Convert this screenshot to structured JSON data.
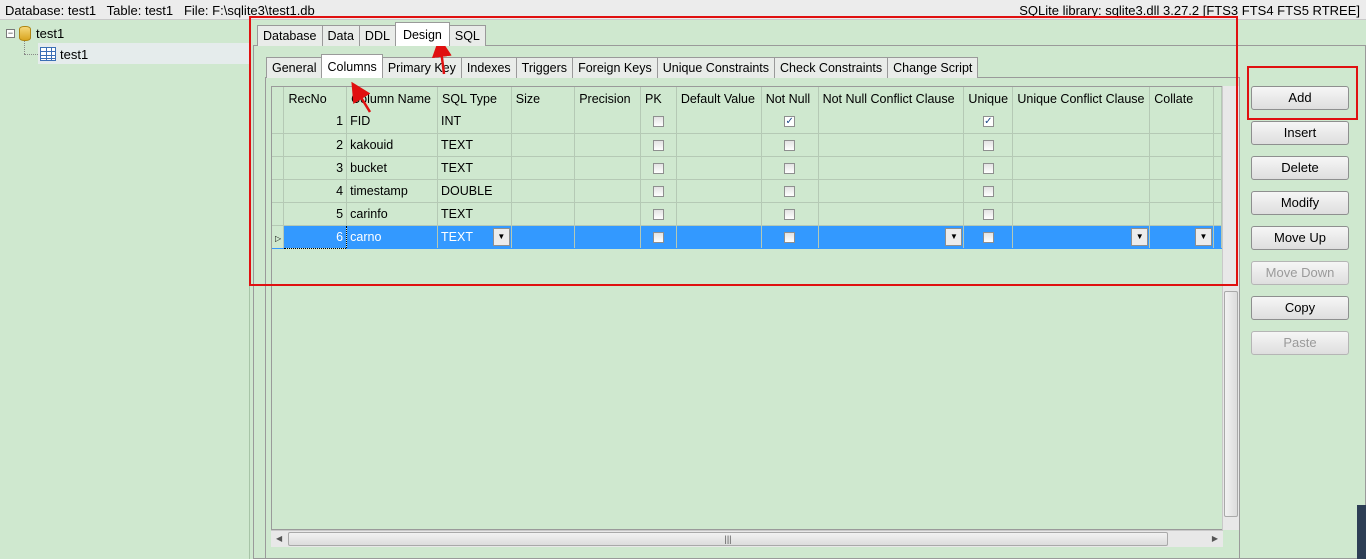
{
  "statusbar": {
    "left": "Database: test1   Table: test1   File: F:\\sqlite3\\test1.db",
    "right": "SQLite library: sqlite3.dll 3.27.2 [FTS3 FTS4 FTS5 RTREE]"
  },
  "tree": {
    "database": "test1",
    "table": "test1"
  },
  "main_tabs": [
    "Database",
    "Data",
    "DDL",
    "Design",
    "SQL"
  ],
  "design_tabs": [
    "General",
    "Columns",
    "Primary Key",
    "Indexes",
    "Triggers",
    "Foreign Keys",
    "Unique Constraints",
    "Check Constraints",
    "Change Script"
  ],
  "grid": {
    "headers": [
      "RecNo",
      "Column Name",
      "SQL Type",
      "Size",
      "Precision",
      "PK",
      "Default Value",
      "Not Null",
      "Not Null Conflict Clause",
      "Unique",
      "Unique Conflict Clause",
      "Collate"
    ],
    "rows": [
      {
        "recno": "1",
        "name": "FID",
        "type": "INT",
        "not_null": true,
        "unique": true
      },
      {
        "recno": "2",
        "name": "kakouid",
        "type": "TEXT",
        "not_null": false,
        "unique": false
      },
      {
        "recno": "3",
        "name": "bucket",
        "type": "TEXT",
        "not_null": false,
        "unique": false
      },
      {
        "recno": "4",
        "name": "timestamp",
        "type": "DOUBLE",
        "not_null": false,
        "unique": false
      },
      {
        "recno": "5",
        "name": "carinfo",
        "type": "TEXT",
        "not_null": false,
        "unique": false
      },
      {
        "recno": "6",
        "name": "carno",
        "type": "TEXT",
        "not_null": false,
        "unique": false,
        "selected": true
      }
    ]
  },
  "buttons": {
    "add": "Add",
    "insert": "Insert",
    "delete": "Delete",
    "modify": "Modify",
    "move_up": "Move Up",
    "move_down": "Move Down",
    "copy": "Copy",
    "paste": "Paste"
  },
  "colors": {
    "panel_bg": "#cfe8cf",
    "selection": "#3399ff",
    "annotation": "#e01010"
  }
}
